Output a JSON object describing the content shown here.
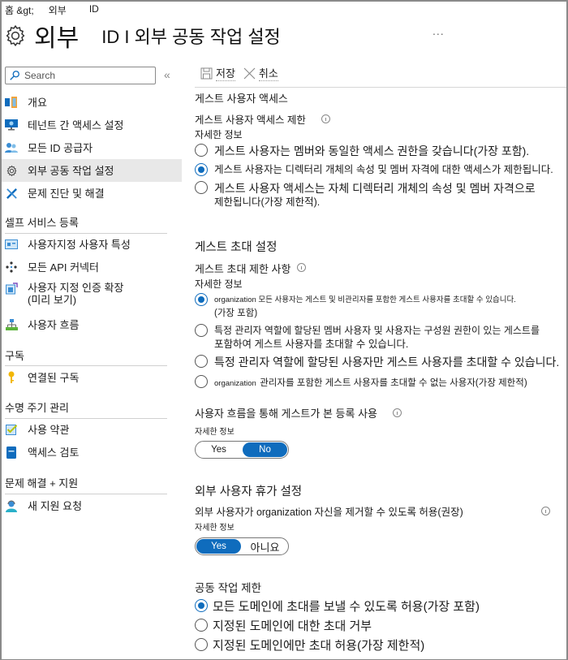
{
  "breadcrumb": {
    "home": "홈 &gt;",
    "external": "외부",
    "id": "ID"
  },
  "header": {
    "title_main": "외부",
    "title_sub": "ID I 외부 공동 작업 설정",
    "more": "..."
  },
  "sidebar": {
    "search_placeholder": "Search",
    "collapse": "«",
    "items": [
      {
        "label": "개요",
        "icon": "overview-icon"
      },
      {
        "label": "테넌트 간 액세스 설정",
        "icon": "monitor-icon"
      },
      {
        "label": "모든 ID 공급자",
        "icon": "users-icon"
      },
      {
        "label": "외부 공동 작업 설정",
        "icon": "gear-icon",
        "active": true
      },
      {
        "label": "문제 진단 및 해결",
        "icon": "wrench-icon"
      }
    ],
    "sections": [
      {
        "title": "셀프 서비스 등록",
        "items": [
          {
            "label": "사용자지정 사용자 특성",
            "icon": "attributes-icon"
          },
          {
            "label": "모든 API 커넥터",
            "icon": "api-connector-icon"
          },
          {
            "label": "사용자 지정 인증 확장",
            "label2": "(미리 보기)",
            "icon": "extension-icon"
          },
          {
            "label": "사용자 흐름",
            "icon": "user-flow-icon"
          }
        ]
      },
      {
        "title": "구독",
        "items": [
          {
            "label": "연결된 구독",
            "icon": "key-icon"
          }
        ]
      },
      {
        "title": "수명 주기 관리",
        "items": [
          {
            "label": "사용 약관",
            "icon": "checkbox-icon"
          },
          {
            "label": "액세스 검토",
            "icon": "review-icon"
          }
        ]
      },
      {
        "title": "문제 해결 + 지원",
        "items": [
          {
            "label": "새 지원 요청",
            "icon": "support-icon"
          }
        ]
      }
    ]
  },
  "toolbar": {
    "save_label": "저장",
    "cancel_label": "취소"
  },
  "guest_access": {
    "section_title": "게스트 사용자 액세스",
    "label": "게스트 사용자 액세스 제한",
    "learn_more": "자세한 정보",
    "options": [
      {
        "text": "게스트 사용자는 멤버와 동일한 액세스 권한을 갖습니다(가장 포함).",
        "selected": false
      },
      {
        "text": "게스트 사용자는 디렉터리 개체의 속성 및 멤버 자격에 대한 액세스가 제한됩니다.",
        "selected": true
      },
      {
        "text": "게스트 사용자 액세스는 자체 디렉터리 개체의 속성 및 멤버 자격으로",
        "text2": "제한됩니다(가장 제한적).",
        "selected": false
      }
    ]
  },
  "guest_invite": {
    "section_title": "게스트 초대 설정",
    "label": "게스트 초대 제한 사항",
    "learn_more": "자세한 정보",
    "options": [
      {
        "text": "organization 모든 사용자는 게스트 및 비관리자를 포함한 게스트 사용자를 초대할 수 있습니다.",
        "text2": "(가장 포함)",
        "selected": true
      },
      {
        "text": "특정 관리자 역할에 할당된 멤버 사용자 및 사용자는 구성원 권한이 있는 게스트를",
        "text2": "포함하여 게스트 사용자를 초대할 수 있습니다.",
        "selected": false
      },
      {
        "text": "특정 관리자 역할에 할당된 사용자만 게스트 사용자를 초대할 수 있습니다.",
        "selected": false
      },
      {
        "prefix": "organization",
        "text": "관리자를 포함한 게스트 사용자를 초대할 수 없는 사용자(가장 제한적)",
        "selected": false
      }
    ]
  },
  "self_service": {
    "label": "사용자 흐름을 통해 게스트가 본 등록 사용",
    "learn_more": "자세한 정보",
    "yes": "Yes",
    "no": "No",
    "value": "No"
  },
  "leave_settings": {
    "section_title": "외부 사용자 휴가 설정",
    "label": "외부 사용자가 organization 자신을 제거할 수 있도록 허용(권장)",
    "learn_more": "자세한 정보",
    "yes": "Yes",
    "no": "아니요",
    "value": "Yes"
  },
  "collab_restrictions": {
    "section_title": "공동 작업 제한",
    "options": [
      {
        "text": "모든 도메인에 초대를 보낼 수 있도록 허용(가장 포함)",
        "selected": true
      },
      {
        "text": "지정된 도메인에 대한 초대 거부",
        "selected": false
      },
      {
        "text": "지정된 도메인에만 초대 허용(가장 제한적)",
        "selected": false
      }
    ]
  },
  "colors": {
    "accent": "#0f6cbd",
    "active_item_bg": "#e8e8e8"
  }
}
